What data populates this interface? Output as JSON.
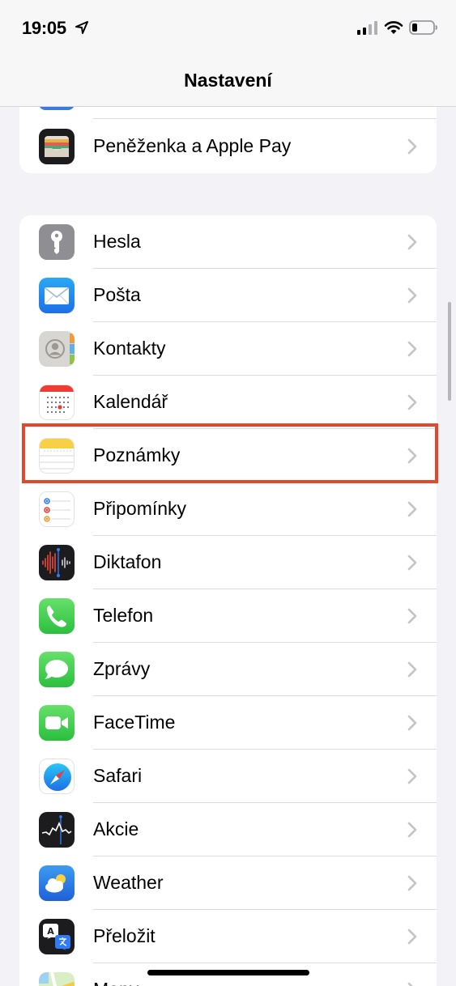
{
  "status_bar": {
    "time": "19:05",
    "icons": [
      "location-arrow-icon",
      "cellular-signal-icon",
      "wifi-icon",
      "battery-icon"
    ]
  },
  "nav": {
    "title": "Nastavení"
  },
  "top_group": {
    "items": [
      {
        "label": "Peněženka a Apple Pay",
        "icon": "wallet-icon"
      }
    ]
  },
  "main_group": {
    "items": [
      {
        "label": "Hesla",
        "icon": "key-icon"
      },
      {
        "label": "Pošta",
        "icon": "mail-icon"
      },
      {
        "label": "Kontakty",
        "icon": "contacts-icon"
      },
      {
        "label": "Kalendář",
        "icon": "calendar-icon"
      },
      {
        "label": "Poznámky",
        "icon": "notes-icon",
        "highlighted": true
      },
      {
        "label": "Připomínky",
        "icon": "reminders-icon"
      },
      {
        "label": "Diktafon",
        "icon": "voice-memos-icon"
      },
      {
        "label": "Telefon",
        "icon": "phone-icon"
      },
      {
        "label": "Zprávy",
        "icon": "messages-icon"
      },
      {
        "label": "FaceTime",
        "icon": "facetime-icon"
      },
      {
        "label": "Safari",
        "icon": "safari-icon"
      },
      {
        "label": "Akcie",
        "icon": "stocks-icon"
      },
      {
        "label": "Weather",
        "icon": "weather-icon"
      },
      {
        "label": "Přeložit",
        "icon": "translate-icon"
      },
      {
        "label": "Mapy",
        "icon": "maps-icon"
      }
    ]
  },
  "colors": {
    "highlight": "#e2492c",
    "background": "#f2f2f7",
    "chevron": "#c4c4c7"
  }
}
